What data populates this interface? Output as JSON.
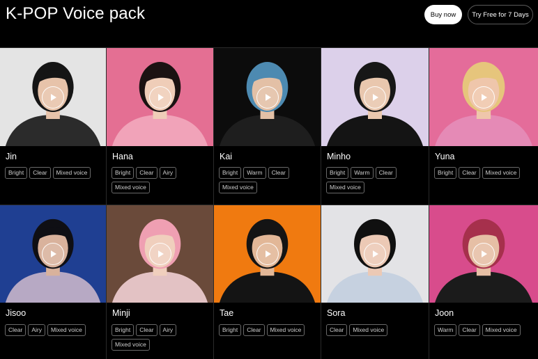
{
  "header": {
    "title": "K-POP Voice pack",
    "buy_label": "Buy now",
    "trial_label": "Try Free for 7 Days"
  },
  "voices": [
    {
      "name": "Jin",
      "tags": [
        "Bright",
        "Clear",
        "Mixed voice"
      ],
      "bg": "#e4e4e4",
      "skin": "#e7c3aa",
      "hair": "#151515",
      "outfit": "#2b2b2b"
    },
    {
      "name": "Hana",
      "tags": [
        "Bright",
        "Clear",
        "Airy",
        "Mixed voice"
      ],
      "bg": "#e46f93",
      "skin": "#efcdb8",
      "hair": "#1b1212",
      "outfit": "#f1a3b9"
    },
    {
      "name": "Kai",
      "tags": [
        "Bright",
        "Warm",
        "Clear",
        "Mixed voice"
      ],
      "bg": "#0c0c0c",
      "skin": "#e3c0a6",
      "hair": "#4d8ab1",
      "outfit": "#1e1e1e"
    },
    {
      "name": "Minho",
      "tags": [
        "Bright",
        "Warm",
        "Clear",
        "Mixed voice"
      ],
      "bg": "#dcd0ea",
      "skin": "#e9c7ae",
      "hair": "#171717",
      "outfit": "#141414"
    },
    {
      "name": "Yuna",
      "tags": [
        "Bright",
        "Clear",
        "Mixed voice"
      ],
      "bg": "#e46c9a",
      "skin": "#efc6ab",
      "hair": "#e6c57c",
      "outfit": "#e58ab6"
    },
    {
      "name": "Jisoo",
      "tags": [
        "Clear",
        "Airy",
        "Mixed voice"
      ],
      "bg": "#1f3f92",
      "skin": "#d9b29c",
      "hair": "#0f0f14",
      "outfit": "#b7a9c4"
    },
    {
      "name": "Minji",
      "tags": [
        "Bright",
        "Clear",
        "Airy",
        "Mixed voice"
      ],
      "bg": "#6a4a3a",
      "skin": "#f0cfbd",
      "hair": "#ef9fb2",
      "outfit": "#e3c2c4"
    },
    {
      "name": "Tae",
      "tags": [
        "Bright",
        "Clear",
        "Mixed voice"
      ],
      "bg": "#f07a10",
      "skin": "#e2b797",
      "hair": "#141414",
      "outfit": "#141414"
    },
    {
      "name": "Sora",
      "tags": [
        "Clear",
        "Mixed voice"
      ],
      "bg": "#e3e3e6",
      "skin": "#ecc9b5",
      "hair": "#101010",
      "outfit": "#c6d1e0"
    },
    {
      "name": "Joon",
      "tags": [
        "Warm",
        "Clear",
        "Mixed voice"
      ],
      "bg": "#d84c8c",
      "skin": "#e6bfa5",
      "hair": "#a6304c",
      "outfit": "#1b1b1b"
    }
  ],
  "icons": {
    "play": "play-icon"
  }
}
